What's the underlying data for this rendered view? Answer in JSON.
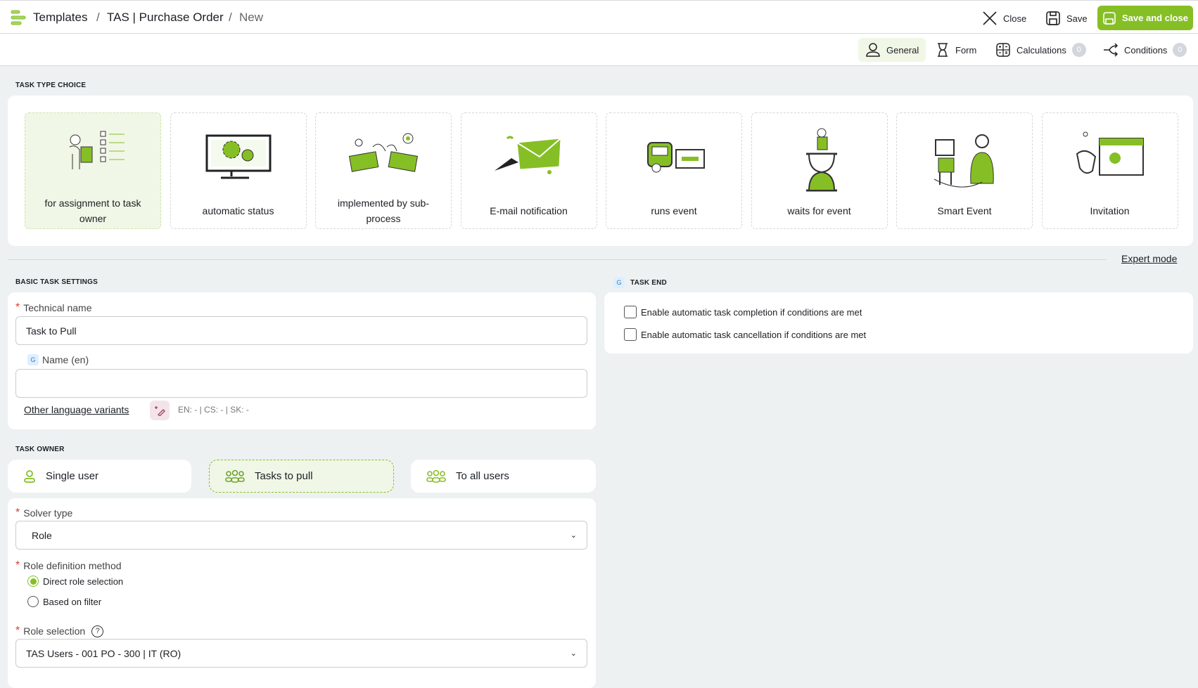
{
  "header": {
    "breadcrumb": [
      "Templates",
      "TAS | Purchase Order",
      "New"
    ],
    "close": "Close",
    "save": "Save",
    "save_and_close": "Save and close"
  },
  "tabs": [
    {
      "label": "General"
    },
    {
      "label": "Form"
    },
    {
      "label": "Calculations",
      "count": "0"
    },
    {
      "label": "Conditions",
      "count": "0"
    }
  ],
  "task_type": {
    "title": "TASK TYPE CHOICE",
    "cards": [
      "for assignment to task owner",
      "automatic status",
      "implemented by sub-process",
      "E-mail notification",
      "runs event",
      "waits for event",
      "Smart Event",
      "Invitation"
    ]
  },
  "expert_mode": "Expert mode",
  "basic": {
    "title": "BASIC TASK SETTINGS",
    "technical_name_label": "Technical name",
    "technical_name_value": "Task to Pull",
    "name_label": "Name (en)",
    "name_value": "",
    "g_badge": "G",
    "other_lang": "Other language variants",
    "lang_status": "EN: - | CS: - | SK: -"
  },
  "task_end": {
    "title": "TASK END",
    "g_badge": "G",
    "options": [
      "Enable automatic task completion if conditions are met",
      "Enable automatic task cancellation if conditions are met"
    ]
  },
  "owner": {
    "title": "TASK OWNER",
    "options": [
      "Single user",
      "Tasks to pull",
      "To all users"
    ],
    "selected": "Tasks to pull"
  },
  "solver": {
    "solver_type_label": "Solver type",
    "solver_type_value": "Role",
    "role_method_label": "Role definition method",
    "role_methods": [
      "Direct role selection",
      "Based on filter"
    ],
    "role_method_selected": "Direct role selection",
    "role_selection_label": "Role selection",
    "role_selection_value": "TAS Users - 001 PO - 300 | IT (RO)"
  },
  "colors": {
    "accent": "#86bf25"
  }
}
